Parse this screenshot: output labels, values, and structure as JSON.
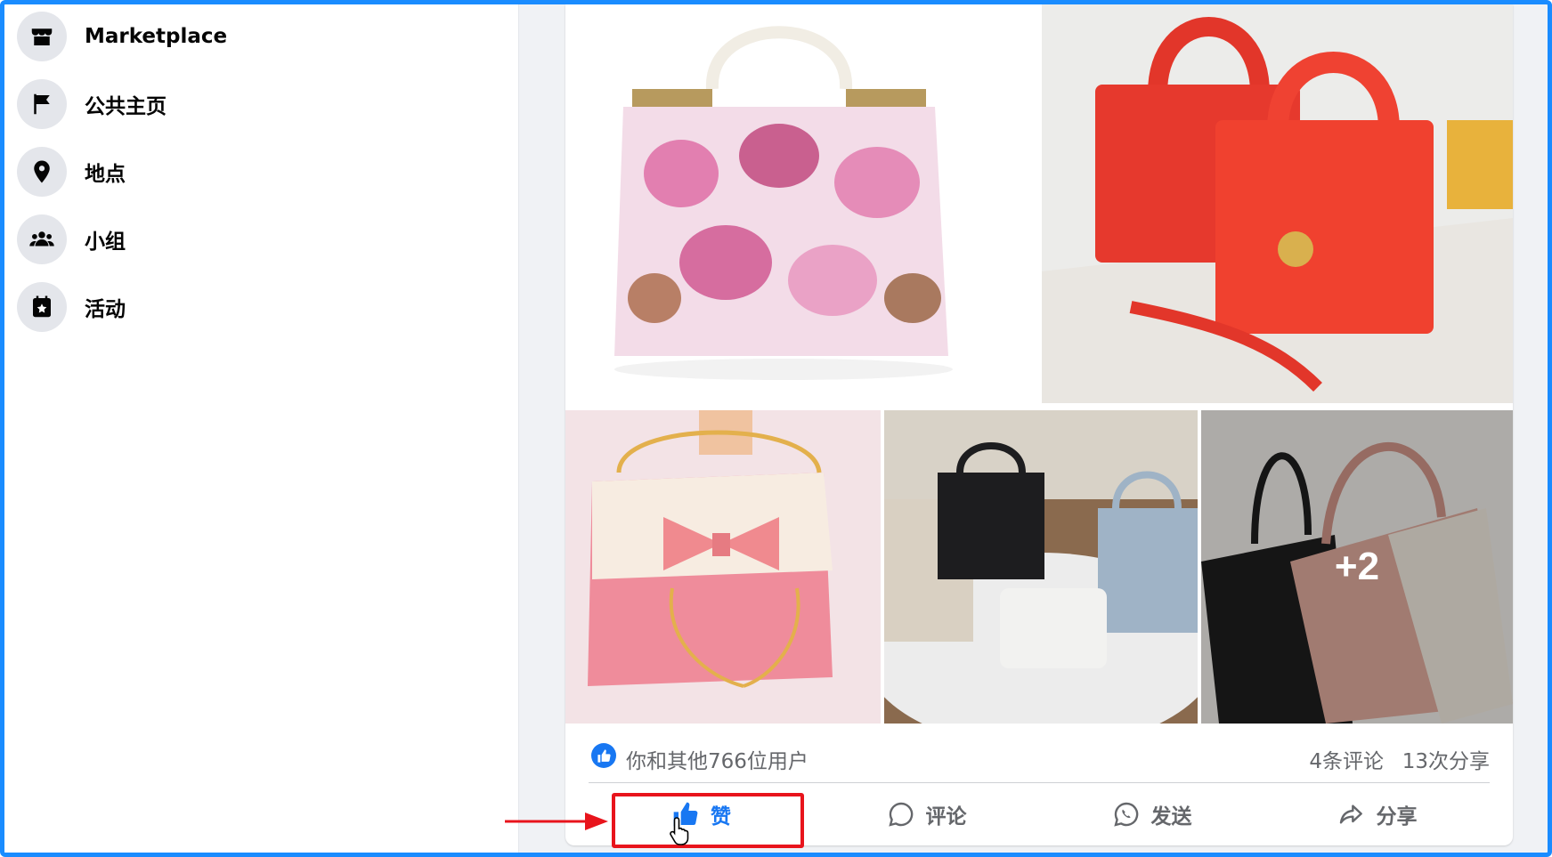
{
  "sidebar": {
    "items": [
      {
        "label": "Marketplace",
        "icon": "storefront-icon"
      },
      {
        "label": "公共主页",
        "icon": "flag-icon"
      },
      {
        "label": "地点",
        "icon": "location-pin-icon"
      },
      {
        "label": "小组",
        "icon": "groups-icon"
      },
      {
        "label": "活动",
        "icon": "calendar-star-icon"
      }
    ]
  },
  "post": {
    "photos": [
      {
        "subject": "floral pink handbag"
      },
      {
        "subject": "red quilted handbags"
      },
      {
        "subject": "pink bow chain bag"
      },
      {
        "subject": "assorted handbags on rug"
      },
      {
        "subject": "newspaper print tote bags"
      }
    ],
    "more_photos_label": "+2",
    "stats": {
      "likes_text": "你和其他766位用户",
      "comments": "4条评论",
      "shares": "13次分享"
    },
    "actions": {
      "like": "赞",
      "comment": "评论",
      "send": "发送",
      "share": "分享"
    }
  },
  "colors": {
    "accent": "#1877f2",
    "annotation": "#e8141c",
    "frame": "#1a8cff"
  }
}
